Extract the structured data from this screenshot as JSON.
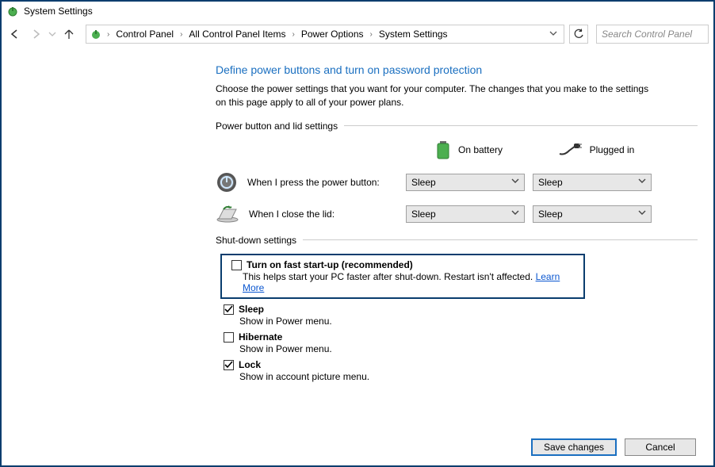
{
  "window": {
    "title": "System Settings"
  },
  "nav": {
    "breadcrumbs": [
      "Control Panel",
      "All Control Panel Items",
      "Power Options",
      "System Settings"
    ],
    "search_placeholder": "Search Control Panel"
  },
  "page": {
    "heading": "Define power buttons and turn on password protection",
    "description": "Choose the power settings that you want for your computer. The changes that you make to the settings on this page apply to all of your power plans."
  },
  "power_section": {
    "group_label": "Power button and lid settings",
    "col_battery": "On battery",
    "col_plugged": "Plugged in",
    "rows": [
      {
        "label": "When I press the power button:",
        "battery": "Sleep",
        "plugged": "Sleep"
      },
      {
        "label": "When I close the lid:",
        "battery": "Sleep",
        "plugged": "Sleep"
      }
    ]
  },
  "shutdown_section": {
    "group_label": "Shut-down settings",
    "items": [
      {
        "checked": false,
        "title": "Turn on fast start-up (recommended)",
        "sub": "This helps start your PC faster after shut-down. Restart isn't affected.",
        "link": "Learn More",
        "highlight": true
      },
      {
        "checked": true,
        "title": "Sleep",
        "sub": "Show in Power menu."
      },
      {
        "checked": false,
        "title": "Hibernate",
        "sub": "Show in Power menu."
      },
      {
        "checked": true,
        "title": "Lock",
        "sub": "Show in account picture menu."
      }
    ]
  },
  "footer": {
    "save": "Save changes",
    "cancel": "Cancel"
  }
}
